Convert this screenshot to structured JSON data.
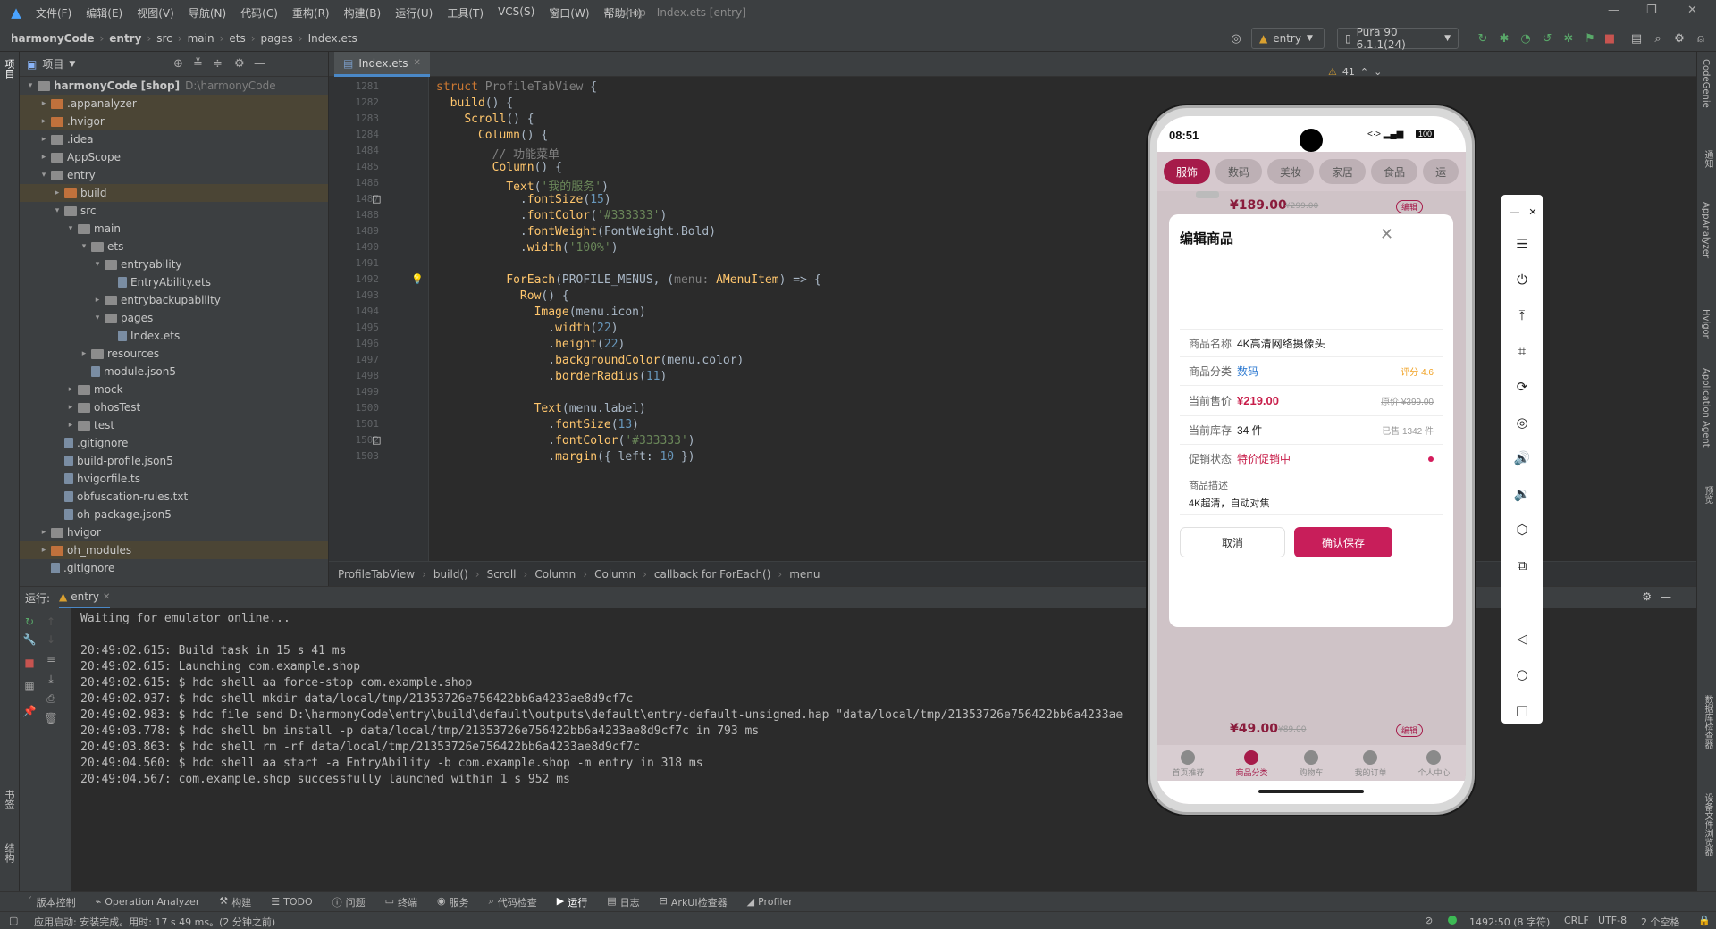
{
  "menubar": {
    "items": [
      "文件(F)",
      "编辑(E)",
      "视图(V)",
      "导航(N)",
      "代码(C)",
      "重构(R)",
      "构建(B)",
      "运行(U)",
      "工具(T)",
      "VCS(S)",
      "窗口(W)",
      "帮助(H)"
    ],
    "title": "shop - Index.ets [entry]"
  },
  "navbar": {
    "breadcrumb": [
      "harmonyCode",
      "entry",
      "src",
      "main",
      "ets",
      "pages",
      "Index.ets"
    ],
    "run_config": "entry",
    "device": "Pura 90 6.1.1(24)"
  },
  "project": {
    "title": "项目",
    "rows": [
      {
        "name": "harmonyCode [shop]",
        "extra": "D:\\harmonyCode",
        "depth": 0,
        "open": true,
        "kind": "folder",
        "sel": false
      },
      {
        "name": ".appanalyzer",
        "depth": 1,
        "open": false,
        "kind": "ofolder",
        "sel": true
      },
      {
        "name": ".hvigor",
        "depth": 1,
        "open": false,
        "kind": "ofolder",
        "sel": true
      },
      {
        "name": ".idea",
        "depth": 1,
        "open": false,
        "kind": "folder",
        "sel": false
      },
      {
        "name": "AppScope",
        "depth": 1,
        "open": false,
        "kind": "folder",
        "sel": false
      },
      {
        "name": "entry",
        "depth": 1,
        "open": true,
        "kind": "folder",
        "sel": false
      },
      {
        "name": "build",
        "depth": 2,
        "open": false,
        "kind": "ofolder",
        "sel": true
      },
      {
        "name": "src",
        "depth": 2,
        "open": true,
        "kind": "folder",
        "sel": false
      },
      {
        "name": "main",
        "depth": 3,
        "open": true,
        "kind": "folder",
        "sel": false
      },
      {
        "name": "ets",
        "depth": 4,
        "open": true,
        "kind": "folder",
        "sel": false
      },
      {
        "name": "entryability",
        "depth": 5,
        "open": true,
        "kind": "folder",
        "sel": false
      },
      {
        "name": "EntryAbility.ets",
        "depth": 6,
        "open": null,
        "kind": "file",
        "sel": false
      },
      {
        "name": "entrybackupability",
        "depth": 5,
        "open": false,
        "kind": "folder",
        "sel": false
      },
      {
        "name": "pages",
        "depth": 5,
        "open": true,
        "kind": "folder",
        "sel": false
      },
      {
        "name": "Index.ets",
        "depth": 6,
        "open": null,
        "kind": "file",
        "sel": false
      },
      {
        "name": "resources",
        "depth": 4,
        "open": false,
        "kind": "folder",
        "sel": false
      },
      {
        "name": "module.json5",
        "depth": 4,
        "open": null,
        "kind": "file",
        "sel": false
      },
      {
        "name": "mock",
        "depth": 3,
        "open": false,
        "kind": "folder",
        "sel": false
      },
      {
        "name": "ohosTest",
        "depth": 3,
        "open": false,
        "kind": "folder",
        "sel": false
      },
      {
        "name": "test",
        "depth": 3,
        "open": false,
        "kind": "folder",
        "sel": false
      },
      {
        "name": ".gitignore",
        "depth": 2,
        "open": null,
        "kind": "file",
        "sel": false
      },
      {
        "name": "build-profile.json5",
        "depth": 2,
        "open": null,
        "kind": "file",
        "sel": false
      },
      {
        "name": "hvigorfile.ts",
        "depth": 2,
        "open": null,
        "kind": "file",
        "sel": false
      },
      {
        "name": "obfuscation-rules.txt",
        "depth": 2,
        "open": null,
        "kind": "file",
        "sel": false
      },
      {
        "name": "oh-package.json5",
        "depth": 2,
        "open": null,
        "kind": "file",
        "sel": false
      },
      {
        "name": "hvigor",
        "depth": 1,
        "open": false,
        "kind": "folder",
        "sel": false
      },
      {
        "name": "oh_modules",
        "depth": 1,
        "open": false,
        "kind": "ofolder",
        "sel": true
      },
      {
        "name": ".gitignore",
        "depth": 1,
        "open": null,
        "kind": "file",
        "sel": false
      }
    ]
  },
  "editor": {
    "tab": "Index.ets",
    "warnings": "41",
    "lines": [
      {
        "n": "1281",
        "html": "<span class=\"k\">struct</span> <span class=\"c\">ProfileTabView</span> {"
      },
      {
        "n": "1282",
        "html": "  <span class=\"f\">build</span>() {"
      },
      {
        "n": "1283",
        "html": "    <span class=\"f\">Scroll</span>() {"
      },
      {
        "n": "1284",
        "html": "      <span class=\"f\">Column</span>() {"
      },
      {
        "n": "1484",
        "html": "        <span class=\"c\">// 功能菜单</span>"
      },
      {
        "n": "1485",
        "html": "        <span class=\"f\">Column</span>() {"
      },
      {
        "n": "1486",
        "html": "          <span class=\"f\">Text</span>(<span class=\"s\">'我的服务'</span>)"
      },
      {
        "n": "1487",
        "html": "            .<span class=\"f\">fontSize</span>(<span class=\"n\">15</span>)"
      },
      {
        "n": "1488",
        "html": "            .<span class=\"f\">fontColor</span>(<span class=\"s\">'#333333'</span>)"
      },
      {
        "n": "1489",
        "html": "            .<span class=\"f\">fontWeight</span>(FontWeight.Bold)"
      },
      {
        "n": "1490",
        "html": "            .<span class=\"f\">width</span>(<span class=\"s\">'100%'</span>)"
      },
      {
        "n": "1491",
        "html": ""
      },
      {
        "n": "1492",
        "html": "          <span class=\"f\">ForEach</span>(PROFILE_MENUS, (<span class=\"c\">menu: </span><span class=\"f\">AMenuItem</span>) => {"
      },
      {
        "n": "1493",
        "html": "            <span class=\"f\">Row</span>() {"
      },
      {
        "n": "1494",
        "html": "              <span class=\"f\">Image</span>(menu.icon)"
      },
      {
        "n": "1495",
        "html": "                .<span class=\"f\">width</span>(<span class=\"n\">22</span>)"
      },
      {
        "n": "1496",
        "html": "                .<span class=\"f\">height</span>(<span class=\"n\">22</span>)"
      },
      {
        "n": "1497",
        "html": "                .<span class=\"f\">backgroundColor</span>(menu.color)"
      },
      {
        "n": "1498",
        "html": "                .<span class=\"f\">borderRadius</span>(<span class=\"n\">11</span>)"
      },
      {
        "n": "1499",
        "html": ""
      },
      {
        "n": "1500",
        "html": "              <span class=\"f\">Text</span>(menu.label)"
      },
      {
        "n": "1501",
        "html": "                .<span class=\"f\">fontSize</span>(<span class=\"n\">13</span>)"
      },
      {
        "n": "1502",
        "html": "                .<span class=\"f\">fontColor</span>(<span class=\"s\">'#333333'</span>)"
      },
      {
        "n": "1503",
        "html": "                .<span class=\"f\">margin</span>({ <span class=\"t\">left</span>: <span class=\"n\">10</span> })"
      }
    ],
    "breadcrumb": [
      "ProfileTabView",
      "build()",
      "Scroll",
      "Column",
      "Column",
      "callback for ForEach()",
      "menu"
    ]
  },
  "run": {
    "label": "运行:",
    "tab": "entry",
    "lines": [
      "Waiting for emulator online...",
      "",
      "20:49:02.615: Build task in 15 s 41 ms",
      "20:49:02.615: Launching com.example.shop",
      "20:49:02.615: $ hdc shell aa force-stop com.example.shop",
      "20:49:02.937: $ hdc shell mkdir data/local/tmp/21353726e756422bb6a4233ae8d9cf7c",
      "20:49:02.983: $ hdc file send D:\\harmonyCode\\entry\\build\\default\\outputs\\default\\entry-default-unsigned.hap \"data/local/tmp/21353726e756422bb6a4233ae",
      "20:49:03.778: $ hdc shell bm install -p data/local/tmp/21353726e756422bb6a4233ae8d9cf7c in 793 ms",
      "20:49:03.863: $ hdc shell rm -rf data/local/tmp/21353726e756422bb6a4233ae8d9cf7c",
      "20:49:04.560: $ hdc shell aa start -a EntryAbility -b com.example.shop -m entry in 318 ms",
      "20:49:04.567: com.example.shop successfully launched within 1 s 952 ms"
    ]
  },
  "left_strip": {
    "project": "项目",
    "bookmarks": "书签",
    "structure": "结构"
  },
  "right_strip": [
    "CodeGenie",
    "通知",
    "AppAnalyzer",
    "Hvigor",
    "Application Agent",
    "预览",
    "数据库检查器",
    "设备文件浏览器"
  ],
  "bottom_tabs": [
    "版本控制",
    "Operation Analyzer",
    "构建",
    "TODO",
    "问题",
    "终端",
    "服务",
    "代码检查",
    "运行",
    "日志",
    "ArkUI检查器",
    "Profiler"
  ],
  "status": {
    "left": "应用启动: 安装完成。用时: 17 s 49 ms。(2 分钟之前)",
    "pos": "1492:50 (8 字符)",
    "eol": "CRLF",
    "enc": "UTF-8",
    "indent": "2 个空格"
  },
  "phone": {
    "time": "08:51",
    "battery": "100",
    "categories": [
      "服饰",
      "数码",
      "美妆",
      "家居",
      "食品",
      "运"
    ],
    "active_category": 0,
    "bg_price_top": "¥189.00",
    "bg_old_top": "¥299.00",
    "bg_price_bottom": "¥49.00",
    "bg_old_bottom": "¥89.00",
    "edit_tag": "编辑",
    "nav": [
      "首页推荐",
      "商品分类",
      "购物车",
      "我的订单",
      "个人中心"
    ],
    "active_nav": 1,
    "dialog": {
      "title": "编辑商品",
      "name_label": "商品名称",
      "name_value": "4K高清网络摄像头",
      "cat_label": "商品分类",
      "cat_value": "数码",
      "rating": "评分 4.6",
      "price_label": "当前售价",
      "price_value": "¥219.00",
      "orig_price": "原价 ¥399.00",
      "stock_label": "当前库存",
      "stock_value": "34 件",
      "sold": "已售 1342 件",
      "promo_label": "促销状态",
      "promo_value": "特价促销中",
      "desc_label": "商品描述",
      "desc_value": "4K超清，自动对焦",
      "cancel": "取消",
      "confirm": "确认保存"
    }
  },
  "colors": {
    "accent": "#a61b4a",
    "link": "#2e7ad1",
    "rating": "#f0a020",
    "selection": "#4b4535"
  }
}
